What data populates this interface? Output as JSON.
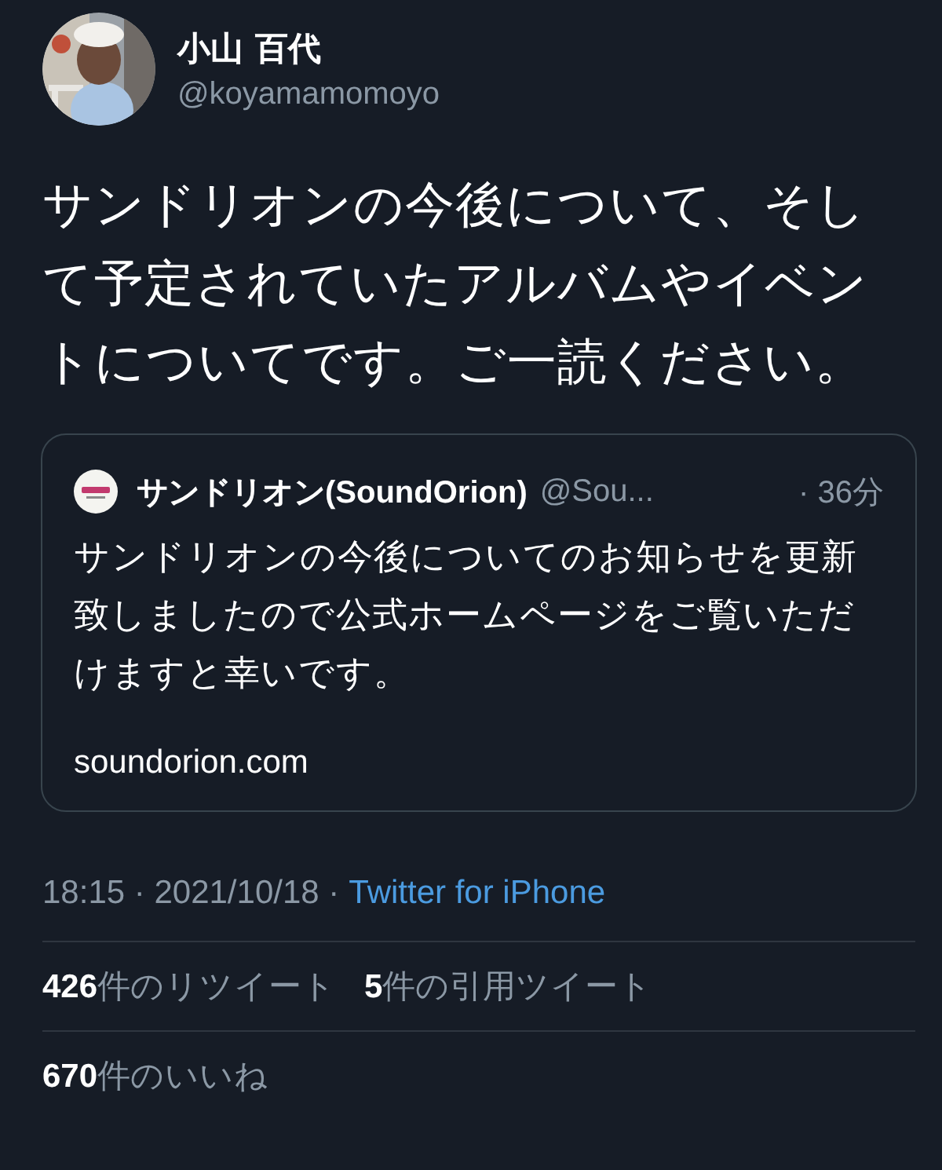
{
  "author": {
    "name": "小山 百代",
    "handle": "@koyamamomoyo"
  },
  "text": "サンドリオンの今後について、そして予定されていたアルバムやイベントについてです。ご一読ください。",
  "quoted": {
    "name": "サンドリオン(SoundOrion)",
    "handle": "@Sou...",
    "time": "· 36分",
    "text": "サンドリオンの今後についてのお知らせを更新致しましたので公式ホームページをご覧いただけますと幸いです。",
    "link": "soundorion.com"
  },
  "meta": {
    "timestamp": "18:15 · 2021/10/18 ·",
    "source": "Twitter for iPhone"
  },
  "stats": [
    {
      "text": "**426**件のリツイート"
    },
    {
      "text": "**5**件の引用ツイート"
    }
  ],
  "likes": "**670**件のいいね"
}
